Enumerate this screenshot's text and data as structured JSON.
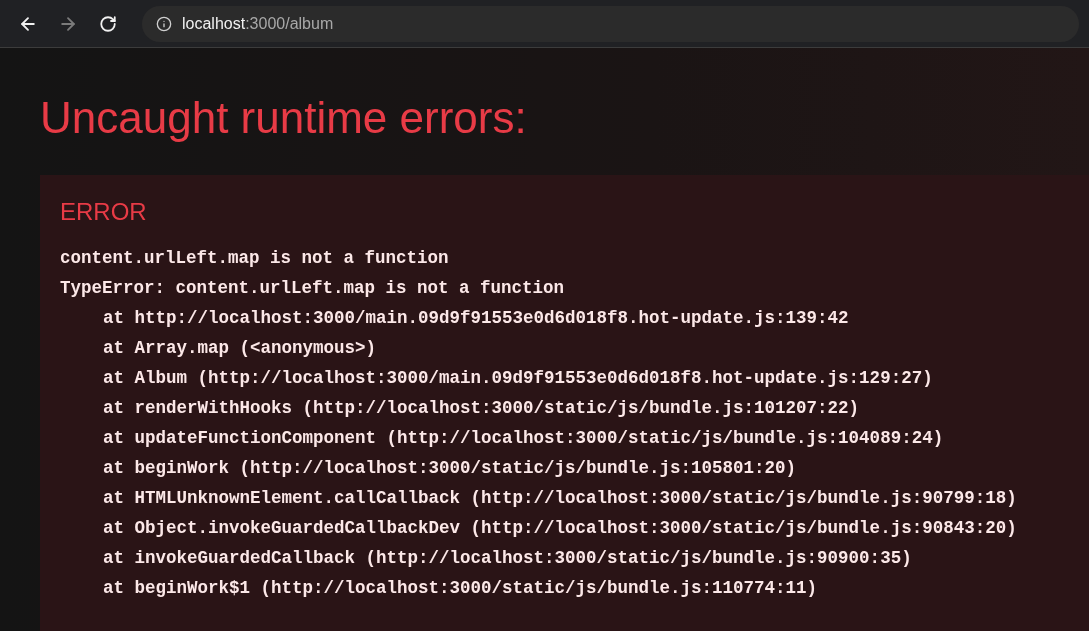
{
  "toolbar": {
    "nav_buttons": [
      {
        "kind": "back",
        "disabled": false
      },
      {
        "kind": "forward",
        "disabled": true
      },
      {
        "kind": "reload",
        "disabled": false
      }
    ],
    "url": {
      "host": "localhost",
      "path": ":3000/album"
    }
  },
  "overlay": {
    "title": "Uncaught runtime errors:",
    "error": {
      "label": "ERROR",
      "message": "content.urlLeft.map is not a function",
      "error_line": "TypeError: content.urlLeft.map is not a function",
      "frames": [
        "at http://localhost:3000/main.09d9f91553e0d6d018f8.hot-update.js:139:42",
        "at Array.map (<anonymous>)",
        "at Album (http://localhost:3000/main.09d9f91553e0d6d018f8.hot-update.js:129:27)",
        "at renderWithHooks (http://localhost:3000/static/js/bundle.js:101207:22)",
        "at updateFunctionComponent (http://localhost:3000/static/js/bundle.js:104089:24)",
        "at beginWork (http://localhost:3000/static/js/bundle.js:105801:20)",
        "at HTMLUnknownElement.callCallback (http://localhost:3000/static/js/bundle.js:90799:18)",
        "at Object.invokeGuardedCallbackDev (http://localhost:3000/static/js/bundle.js:90843:20)",
        "at invokeGuardedCallback (http://localhost:3000/static/js/bundle.js:90900:35)",
        "at beginWork$1 (http://localhost:3000/static/js/bundle.js:110774:11)"
      ]
    }
  }
}
